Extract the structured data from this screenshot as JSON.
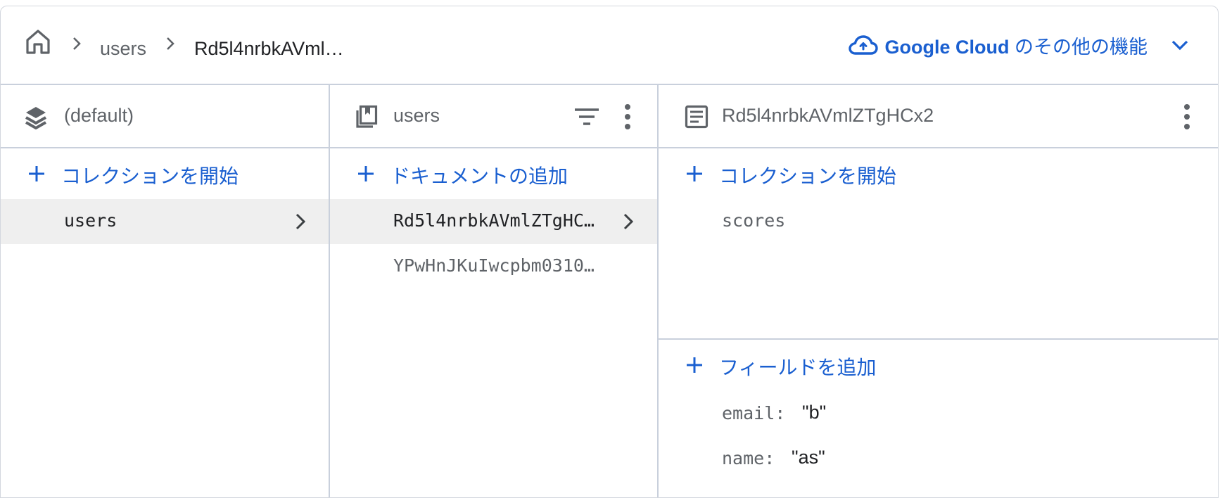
{
  "breadcrumb": {
    "home_icon": "home-icon",
    "items": [
      "users",
      "Rd5l4nrbkAVml…"
    ]
  },
  "google_cloud": {
    "brand": "Google Cloud",
    "suffix": " のその他の機能",
    "icon": "cloud-icon"
  },
  "colors": {
    "accent": "#1a5fd0",
    "selected_bg": "#efefef",
    "border": "#c9d0dc"
  },
  "columns": {
    "database": {
      "title": "(default)",
      "add_label": "コレクションを開始",
      "items": [
        {
          "label": "users",
          "selected": true
        }
      ]
    },
    "collection": {
      "title": "users",
      "add_label": "ドキュメントの追加",
      "items": [
        {
          "label": "Rd5l4nrbkAVmlZTgHC…",
          "selected": true
        },
        {
          "label": "YPwHnJKuIwcpbm0310…",
          "selected": false
        }
      ]
    },
    "document": {
      "title": "Rd5l4nrbkAVmlZTgHCx2",
      "add_collection_label": "コレクションを開始",
      "subcollections": [
        {
          "label": "scores"
        }
      ],
      "add_field_label": "フィールドを追加",
      "fields": [
        {
          "key": "email:",
          "value": "\"b\""
        },
        {
          "key": "name:",
          "value": "\"as\""
        }
      ]
    }
  }
}
